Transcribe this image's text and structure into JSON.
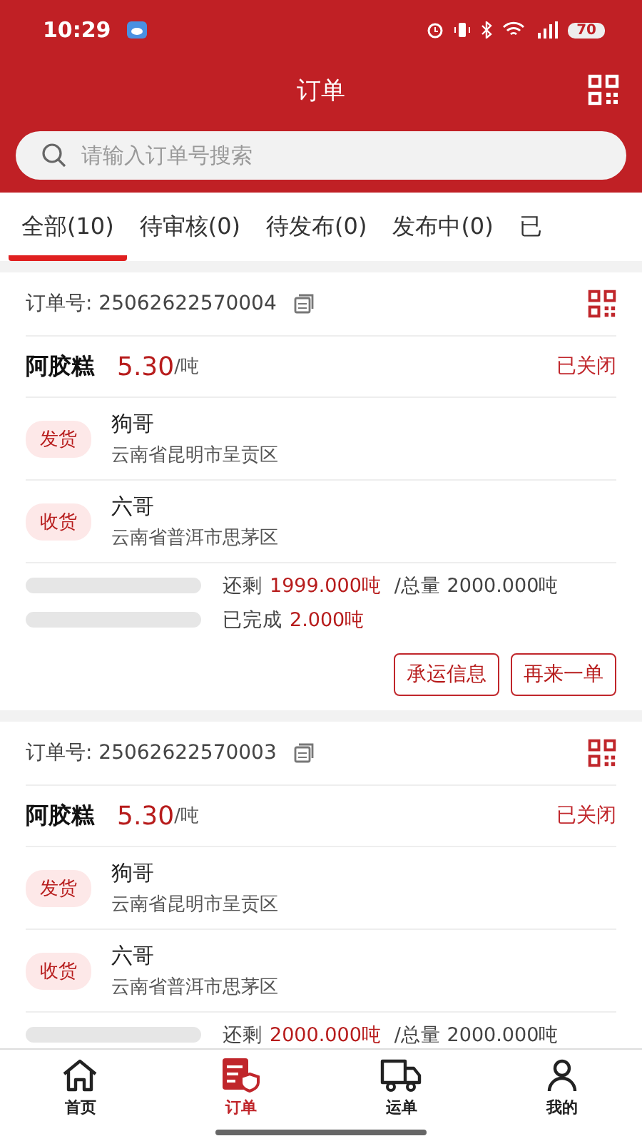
{
  "status_bar": {
    "time": "10:29",
    "battery": "70"
  },
  "header": {
    "title": "订单"
  },
  "search": {
    "placeholder": "请输入订单号搜索"
  },
  "tabs": [
    {
      "label": "全部(10)",
      "selected": true
    },
    {
      "label": "待审核(0)",
      "selected": false
    },
    {
      "label": "待发布(0)",
      "selected": false
    },
    {
      "label": "发布中(0)",
      "selected": false
    },
    {
      "label": "已",
      "selected": false
    }
  ],
  "orders": [
    {
      "order_label": "订单号:",
      "order_no": "25062622570004",
      "product": "阿胶糕",
      "price": "5.30",
      "unit": "/吨",
      "status": "已关闭",
      "parties": [
        {
          "tag": "发货",
          "name": "狗哥",
          "address": "云南省昆明市呈贡区"
        },
        {
          "tag": "收货",
          "name": "六哥",
          "address": "云南省普洱市思茅区"
        }
      ],
      "progress": [
        {
          "label": "还剩",
          "value": "1999.000吨",
          "extra": "/总量 2000.000吨"
        },
        {
          "label": "已完成",
          "value": "2.000吨"
        }
      ],
      "buttons": [
        "承运信息",
        "再来一单"
      ]
    },
    {
      "order_label": "订单号:",
      "order_no": "25062622570003",
      "product": "阿胶糕",
      "price": "5.30",
      "unit": "/吨",
      "status": "已关闭",
      "parties": [
        {
          "tag": "发货",
          "name": "狗哥",
          "address": "云南省昆明市呈贡区"
        },
        {
          "tag": "收货",
          "name": "六哥",
          "address": "云南省普洱市思茅区"
        }
      ],
      "progress": [
        {
          "label": "还剩",
          "value": "2000.000吨",
          "extra": "/总量 2000.000吨"
        }
      ]
    }
  ],
  "bottom_nav": [
    {
      "label": "首页",
      "selected": false
    },
    {
      "label": "订单",
      "selected": true
    },
    {
      "label": "运单",
      "selected": false
    },
    {
      "label": "我的",
      "selected": false
    }
  ]
}
